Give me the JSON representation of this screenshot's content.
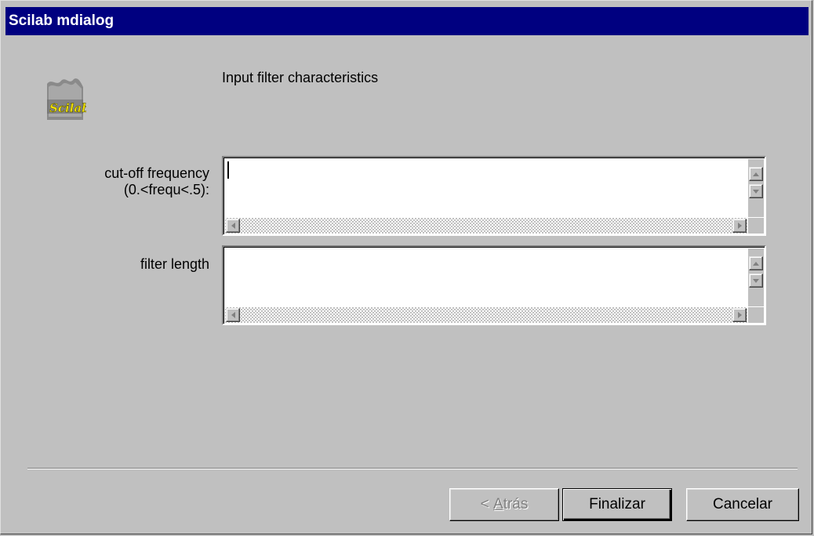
{
  "window": {
    "title": "Scilab mdialog"
  },
  "logo": {
    "text": "Scilab"
  },
  "dialog": {
    "heading": "Input filter characteristics"
  },
  "fields": [
    {
      "label_line1": "cut-off frequency",
      "label_line2": "(0.<frequ<.5):",
      "value": ""
    },
    {
      "label_line1": "filter length",
      "label_line2": "",
      "value": ""
    }
  ],
  "buttons": {
    "back_prefix": "< ",
    "back_accel": "A",
    "back_rest": "trás",
    "finish": "Finalizar",
    "cancel": "Cancelar"
  },
  "icons": {
    "scroll_up": "arrow-up-icon",
    "scroll_down": "arrow-down-icon",
    "scroll_left": "arrow-left-icon",
    "scroll_right": "arrow-right-icon"
  }
}
